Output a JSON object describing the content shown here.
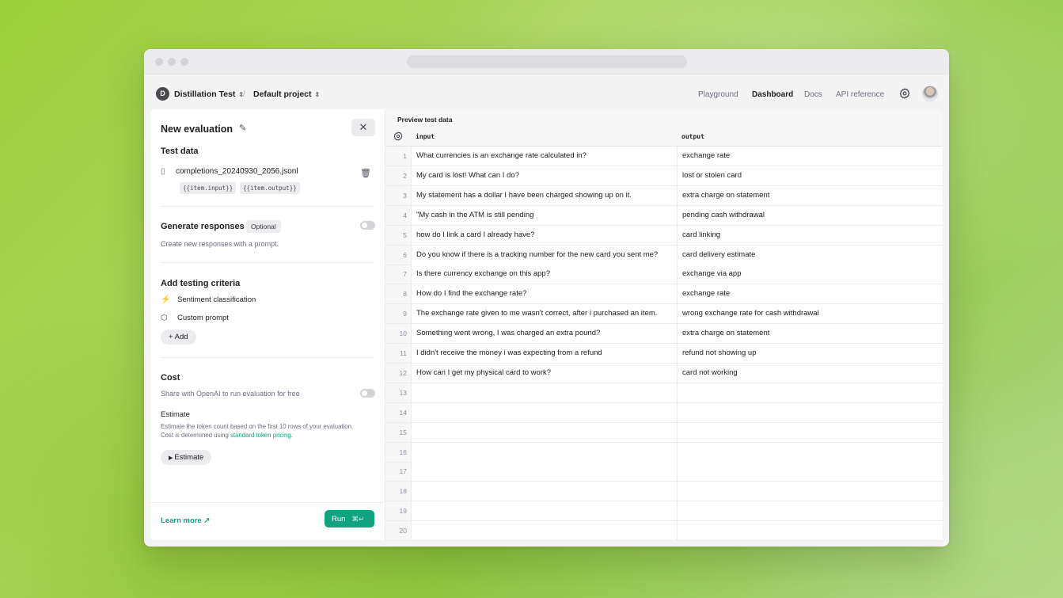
{
  "header": {
    "org_initial": "D",
    "org_name": "Distillation Test",
    "project_name": "Default project",
    "nav": [
      "Playground",
      "Dashboard",
      "Docs",
      "API reference"
    ],
    "active_nav": "Dashboard"
  },
  "panel": {
    "title": "New evaluation",
    "test_data_title": "Test data",
    "file_name": "completions_20240930_2056.jsonl",
    "chips": [
      "{{item.input}}",
      "{{item.output}}"
    ],
    "generate_title": "Generate responses",
    "optional_badge": "Optional",
    "generate_desc": "Create new responses with a prompt.",
    "criteria_title": "Add testing criteria",
    "criteria": [
      "Sentiment classification",
      "Custom prompt"
    ],
    "add_label": "Add",
    "cost_title": "Cost",
    "share_text": "Share with OpenAI to run evaluation for free",
    "estimate_title": "Estimate",
    "estimate_desc_1": "Estimate the token count based on the first 10 rows of your evaluation.",
    "estimate_desc_2": "Cost is determined using",
    "estimate_link": "standard token pricing",
    "estimate_desc_end": ".",
    "estimate_button": "Estimate",
    "learn_more": "Learn more",
    "run_label": "Run",
    "run_shortcut": "⌘↵"
  },
  "preview": {
    "label": "Preview test data",
    "columns": [
      "input",
      "output"
    ],
    "rows": [
      {
        "n": "1",
        "input": "What currencies is an exchange rate calculated in?",
        "output": "exchange rate"
      },
      {
        "n": "2",
        "input": "My card is lost! What can I do?",
        "output": "lost or stolen card"
      },
      {
        "n": "3",
        "input": "My statement has a dollar I have been charged showing up on it.",
        "output": "extra charge on statement"
      },
      {
        "n": "4",
        "input": "\"My cash in the ATM is still pending",
        "output": "pending cash withdrawal"
      },
      {
        "n": "5",
        "input": "how do I link a card I already have?",
        "output": "card linking"
      },
      {
        "n": "6",
        "input": "Do you know if there is a tracking number for the new card you sent me?",
        "output": "card delivery estimate"
      },
      {
        "n": "7",
        "input": "Is there currency exchange on this app?",
        "output": "exchange via app"
      },
      {
        "n": "8",
        "input": "How do I find the exchange rate?",
        "output": "exchange rate"
      },
      {
        "n": "9",
        "input": "The exchange rate given to me wasn't correct, after i purchased an item.",
        "output": "wrong exchange rate for cash withdrawal"
      },
      {
        "n": "10",
        "input": "Something went wrong, I was charged an extra pound?",
        "output": "extra charge on statement"
      },
      {
        "n": "11",
        "input": "I didn't receive the money i was expecting from a refund",
        "output": "refund not showing up"
      },
      {
        "n": "12",
        "input": "How can I get my physical card to work?",
        "output": "card not working"
      },
      {
        "n": "13",
        "input": "",
        "output": ""
      },
      {
        "n": "14",
        "input": "",
        "output": ""
      },
      {
        "n": "15",
        "input": "",
        "output": ""
      },
      {
        "n": "16",
        "input": "",
        "output": ""
      },
      {
        "n": "17",
        "input": "",
        "output": ""
      },
      {
        "n": "18",
        "input": "",
        "output": ""
      },
      {
        "n": "19",
        "input": "",
        "output": ""
      },
      {
        "n": "20",
        "input": "",
        "output": ""
      }
    ]
  }
}
